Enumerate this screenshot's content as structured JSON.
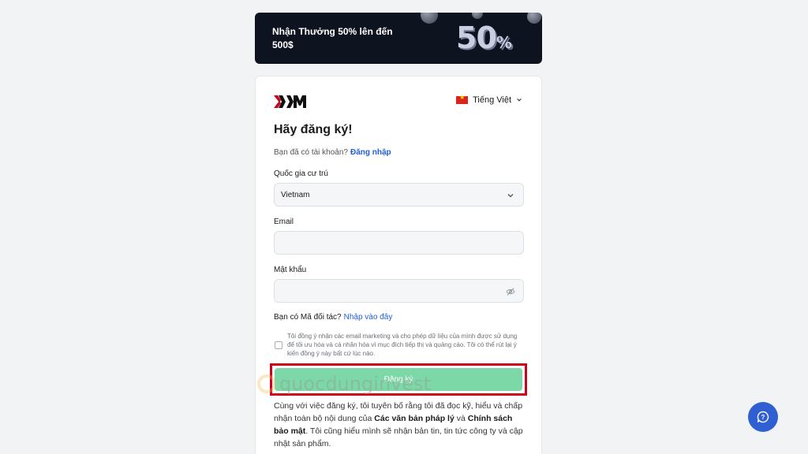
{
  "banner": {
    "text": "Nhận Thưởng 50% lên đến 500$",
    "big_number": "50",
    "big_suffix": "%"
  },
  "header": {
    "logo_text": "XM",
    "language": "Tiếng Việt"
  },
  "form": {
    "title": "Hãy đăng ký!",
    "have_account": "Bạn đã có tài khoản?",
    "login_link": "Đăng nhập",
    "country_label": "Quốc gia cư trú",
    "country_value": "Vietnam",
    "email_label": "Email",
    "email_value": "",
    "password_label": "Mật khẩu",
    "password_value": "",
    "partner_question": "Bạn có Mã đối tác?",
    "partner_link": "Nhập vào đây",
    "consent_text": "Tôi đồng ý nhận các email marketing và cho phép dữ liệu của mình được sử dụng để tối ưu hóa và cá nhân hóa vì mục đích tiếp thị và quảng cáo. Tôi có thể rút lại ý kiến đồng ý này bất cứ lúc nào.",
    "consent_checked": false,
    "submit_label": "Đăng ký"
  },
  "legal": {
    "part1": "Cùng với việc đăng ký, tôi tuyên bố rằng tôi đã đọc kỹ, hiểu và chấp nhận toàn bộ nội dung của",
    "link1": "Các văn bản pháp lý",
    "part2": "và",
    "link2": "Chính sách bảo mật",
    "part3": ". Tôi cũng hiểu mình sẽ nhận bản tin, tin tức công ty và cập nhật sản phẩm."
  },
  "watermark": {
    "text": "quocdunginvest"
  },
  "colors": {
    "accent_link": "#1e5fd6",
    "button_bg": "#7dd8a8",
    "highlight_border": "#d0021b",
    "banner_bg": "#0e1320",
    "help_button": "#2f5fd0"
  },
  "icons": {
    "eye_off": "eye-off-icon",
    "chevron": "chevron-down-icon",
    "chat": "chat-help-icon"
  }
}
